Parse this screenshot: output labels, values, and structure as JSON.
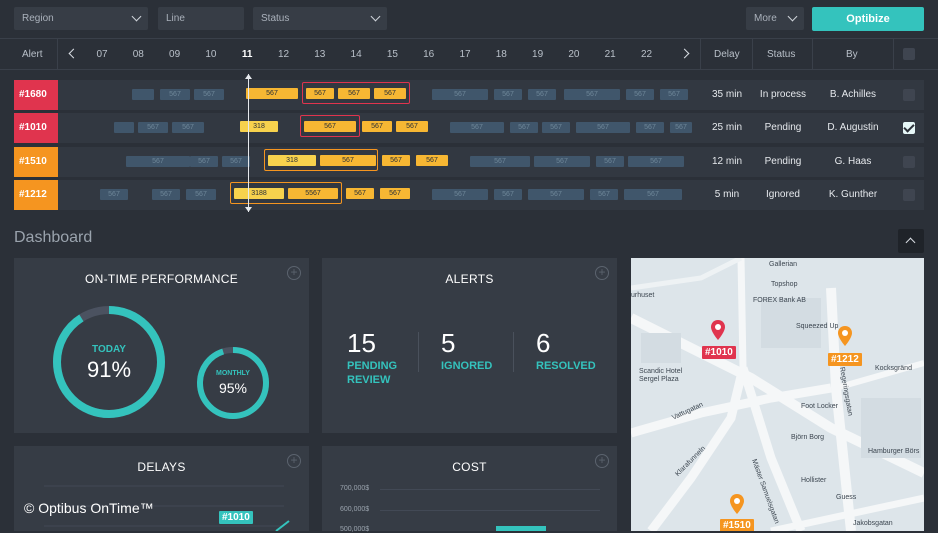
{
  "filters": {
    "region": "Region",
    "line": "Line",
    "status": "Status",
    "more": "More",
    "optimize_button": "Optibize"
  },
  "timeline": {
    "header_alert": "Alert",
    "hours": [
      "07",
      "08",
      "09",
      "10",
      "11",
      "12",
      "13",
      "14",
      "15",
      "16",
      "17",
      "18",
      "19",
      "20",
      "21",
      "22"
    ],
    "current_hour": "11",
    "header_delay": "Delay",
    "header_status": "Status",
    "header_by": "By"
  },
  "rows": [
    {
      "id": "#1680",
      "delay": "35 min",
      "status": "In process",
      "by": "B. Achilles",
      "checked": false,
      "color": "#e0344e"
    },
    {
      "id": "#1010",
      "delay": "25 min",
      "status": "Pending",
      "by": "D. Augustin",
      "checked": true,
      "color": "#e0344e"
    },
    {
      "id": "#1510",
      "delay": "12 min",
      "status": "Pending",
      "by": "G. Haas",
      "checked": false,
      "color": "#f59520"
    },
    {
      "id": "#1212",
      "delay": "5 min",
      "status": "Ignored",
      "by": "K. Gunther",
      "checked": false,
      "color": "#f59520"
    }
  ],
  "trip_labels": {
    "t567": "567",
    "t318": "318",
    "t3188": "3188",
    "t5567": "5567"
  },
  "dashboard": {
    "title": "Dashboard",
    "otp": {
      "title": "ON-TIME PERFORMANCE",
      "today_label": "TODAY",
      "today_value": "91%",
      "today_fraction": 0.91,
      "monthly_label": "MONTHLY",
      "monthly_value": "95%",
      "monthly_fraction": 0.95
    },
    "alerts": {
      "title": "ALERTS",
      "items": [
        {
          "count": "15",
          "label_line1": "PENDING",
          "label_line2": "REVIEW"
        },
        {
          "count": "5",
          "label_line1": "IGNORED",
          "label_line2": ""
        },
        {
          "count": "6",
          "label_line1": "RESOLVED",
          "label_line2": ""
        }
      ]
    },
    "delays": {
      "title": "DELAYS",
      "tag": "#1010"
    },
    "cost": {
      "title": "COST",
      "ticks": [
        "700,000$",
        "600,000$",
        "500,000$"
      ]
    },
    "map": {
      "labels": [
        "Gallerian",
        "Topshop",
        "FOREX Bank AB",
        "Squeezed Up",
        "Scandic Hotel",
        "Sergel Plaza",
        "Vattugatan",
        "Klarafunneln",
        "Foot Locker",
        "Björn Borg",
        "Hamburger Börs",
        "Hollister",
        "Guess",
        "Mäster Samuelsgatan",
        "Regeringsgatan",
        "Kocksgränd",
        "Jakobsgatan",
        "urhuset"
      ],
      "pins": [
        {
          "tag": "#1010",
          "color": "#e0344e"
        },
        {
          "tag": "#1212",
          "color": "#f59520"
        },
        {
          "tag": "#1510",
          "color": "#f59520"
        }
      ]
    }
  },
  "copyright": "© Optibus OnTime™"
}
